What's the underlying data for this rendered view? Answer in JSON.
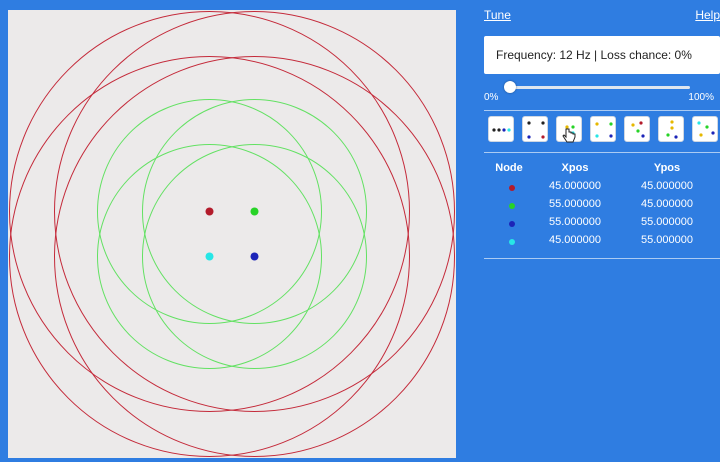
{
  "top_links": {
    "tune": "Tune",
    "help": "Help"
  },
  "status_text": "Frequency: 12 Hz | Loss chance: 0%",
  "loss_slider": {
    "min_label": "0%",
    "max_label": "100%",
    "value": 0
  },
  "colors": {
    "panel_bg": "#2f7de1",
    "canvas_bg": "#eceaea",
    "outer_ring": "#c42a3a",
    "inner_ring": "#63e163"
  },
  "table": {
    "headers": {
      "node": "Node",
      "xpos": "Xpos",
      "ypos": "Ypos"
    },
    "rows": [
      {
        "color": "#b31b2b",
        "xpos": "45.000000",
        "ypos": "45.000000"
      },
      {
        "color": "#27d327",
        "xpos": "55.000000",
        "ypos": "45.000000"
      },
      {
        "color": "#1c24b8",
        "xpos": "55.000000",
        "ypos": "55.000000"
      },
      {
        "color": "#27e6e6",
        "xpos": "45.000000",
        "ypos": "55.000000"
      }
    ]
  },
  "presets": [
    {
      "name": "preset-line-layout"
    },
    {
      "name": "preset-corners-layout"
    },
    {
      "name": "preset-square-layout"
    },
    {
      "name": "preset-wide-layout"
    },
    {
      "name": "preset-mixed-layout"
    },
    {
      "name": "preset-vertical-layout"
    },
    {
      "name": "preset-scattered-layout"
    }
  ]
}
